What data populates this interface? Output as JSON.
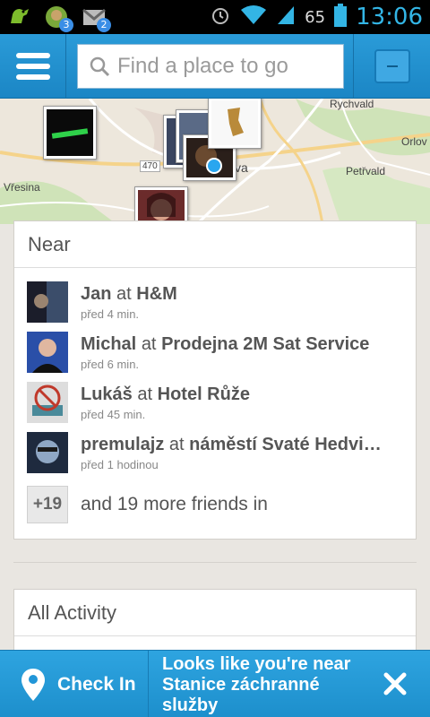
{
  "status_bar": {
    "time": "13:06",
    "battery": "65",
    "notifications": [
      {
        "icon": "android-robot-icon",
        "badge": ""
      },
      {
        "icon": "chat-avatar-icon",
        "badge": "3"
      },
      {
        "icon": "gmail-icon",
        "badge": "2"
      }
    ],
    "system_icons": [
      "alarm-icon",
      "wifi-icon",
      "signal-icon",
      "battery-icon"
    ]
  },
  "header": {
    "search_placeholder": "Find a place to go"
  },
  "map": {
    "labels": [
      "Rychvald",
      "Orlov",
      "Petřvald",
      "Vřesina",
      "470",
      "va"
    ]
  },
  "near": {
    "title": "Near",
    "items": [
      {
        "name": "Jan",
        "connector": "at",
        "place": "H&M",
        "time": "před 4 min."
      },
      {
        "name": "Michal",
        "connector": "at",
        "place": "Prodejna 2M Sat Service",
        "time": "před 6 min."
      },
      {
        "name": "Lukáš",
        "connector": "at",
        "place": "Hotel Růže",
        "time": "před 45 min."
      },
      {
        "name": "premulajz",
        "connector": "at",
        "place": "náměstí Svaté Hedvi…",
        "time": "před 1 hodinou"
      }
    ],
    "more_count": "+19",
    "more_text": "and 19 more friends in"
  },
  "activity": {
    "title": "All Activity"
  },
  "bottom_bar": {
    "checkin_label": "Check In",
    "message": "Looks like you're near Stanice záchranné služby"
  },
  "colors": {
    "accent_blue": "#1b86c5",
    "status_blue": "#33b5e5",
    "background": "#e9e6e1"
  }
}
